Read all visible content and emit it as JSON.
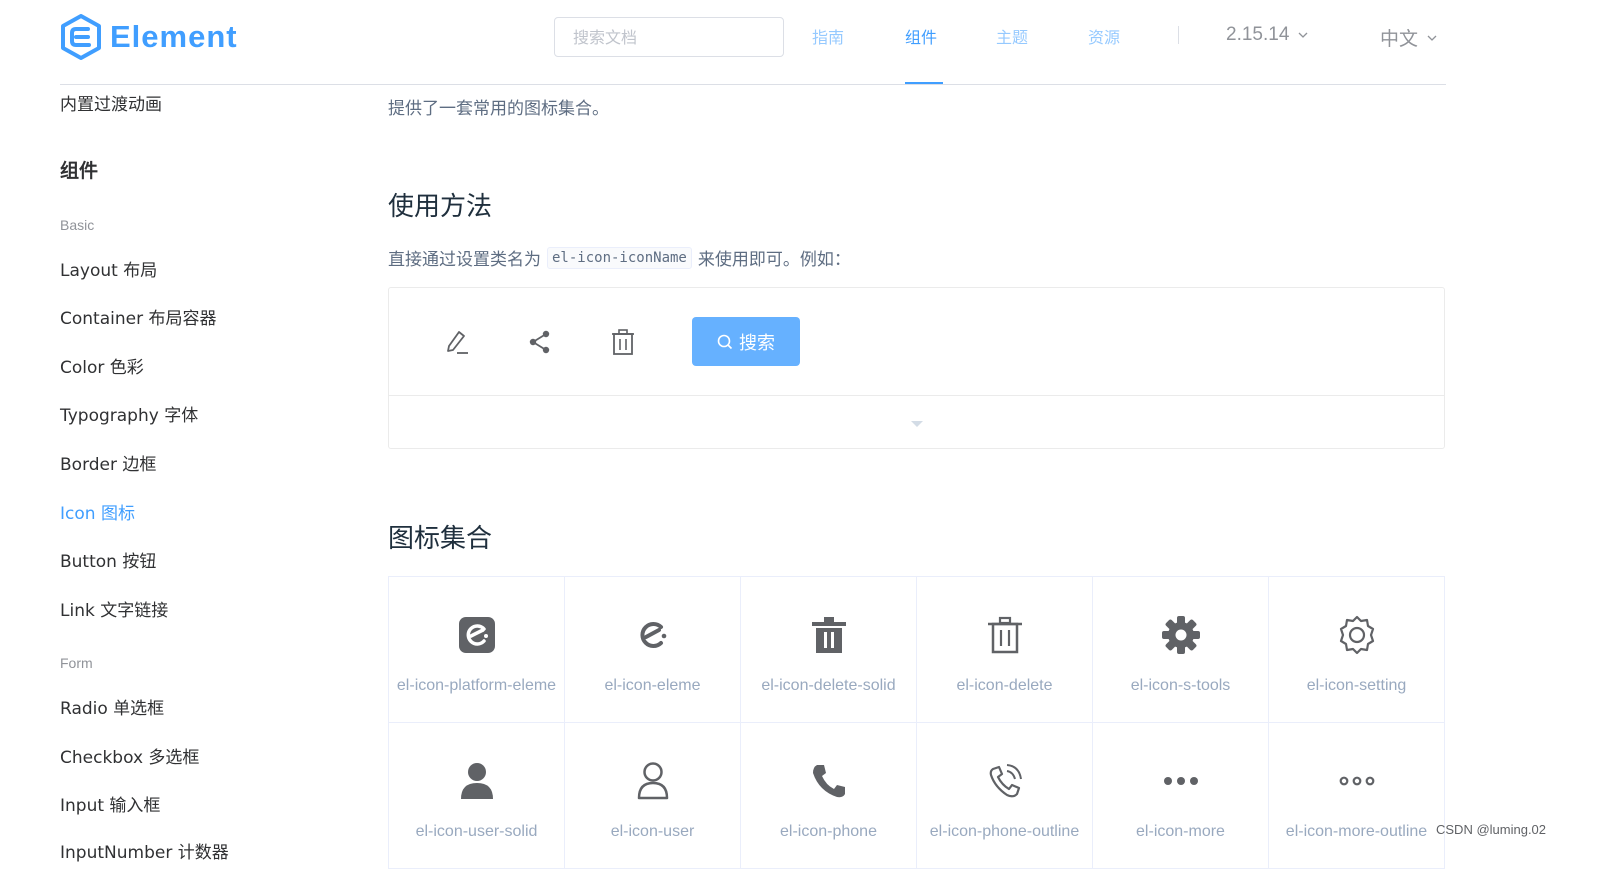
{
  "header": {
    "logo_text": "Element",
    "search_placeholder": "搜索文档",
    "nav": [
      "指南",
      "组件",
      "主题",
      "资源"
    ],
    "active_nav": "组件",
    "version": "2.15.14",
    "language": "中文"
  },
  "sidebar": {
    "top_link": "内置过渡动画",
    "section_title": "组件",
    "group_basic": "Basic",
    "basic_items": [
      "Layout 布局",
      "Container 布局容器",
      "Color 色彩",
      "Typography 字体",
      "Border 边框",
      "Icon 图标",
      "Button 按钮",
      "Link 文字链接"
    ],
    "active_item": "Icon 图标",
    "group_form": "Form",
    "form_items": [
      "Radio 单选框",
      "Checkbox 多选框",
      "Input 输入框",
      "InputNumber 计数器"
    ]
  },
  "main": {
    "intro": "提供了一套常用的图标集合。",
    "usage_title": "使用方法",
    "usage_text_before": "直接通过设置类名为",
    "usage_code": "el-icon-iconName",
    "usage_text_after": "来使用即可。例如：",
    "demo": {
      "icons": [
        "edit-icon",
        "share-icon",
        "delete-icon"
      ],
      "button_label": "搜索"
    },
    "collection_title": "图标集合",
    "icons": [
      {
        "name": "el-icon-platform-eleme",
        "icon": "platform-eleme-icon"
      },
      {
        "name": "el-icon-eleme",
        "icon": "eleme-icon"
      },
      {
        "name": "el-icon-delete-solid",
        "icon": "delete-solid-icon"
      },
      {
        "name": "el-icon-delete",
        "icon": "delete-icon"
      },
      {
        "name": "el-icon-s-tools",
        "icon": "s-tools-icon"
      },
      {
        "name": "el-icon-setting",
        "icon": "setting-icon"
      },
      {
        "name": "el-icon-user-solid",
        "icon": "user-solid-icon"
      },
      {
        "name": "el-icon-user",
        "icon": "user-icon"
      },
      {
        "name": "el-icon-phone",
        "icon": "phone-icon"
      },
      {
        "name": "el-icon-phone-outline",
        "icon": "phone-outline-icon"
      },
      {
        "name": "el-icon-more",
        "icon": "more-icon"
      },
      {
        "name": "el-icon-more-outline",
        "icon": "more-outline-icon"
      }
    ]
  },
  "watermark": "CSDN @luming.02",
  "colors": {
    "primary": "#409eff",
    "button": "#66b1ff",
    "icon": "#606266",
    "icon_label": "#99a9bf"
  }
}
